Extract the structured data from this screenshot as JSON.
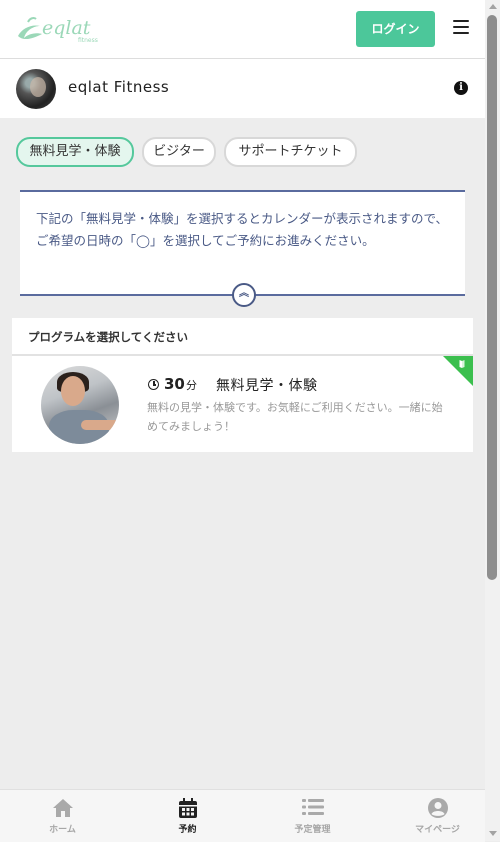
{
  "header": {
    "logo_text": "eqlat",
    "logo_subtext": "fitness",
    "login_label": "ログイン",
    "menu_icon": "hamburger-menu-icon"
  },
  "studio": {
    "name": "eqlat Fitness",
    "info_icon": "info-icon",
    "info_glyph": "i"
  },
  "filters": {
    "chips": [
      {
        "label": "無料見学・体験",
        "active": true
      },
      {
        "label": "ビジター",
        "active": false
      },
      {
        "label": "サポートチケット",
        "active": false
      }
    ]
  },
  "notice": {
    "text": "下記の「無料見学・体験」を選択するとカレンダーが表示されますので、ご希望の日時の「◯」を選択してご予約にお進みください。",
    "collapse_icon": "chevron-double-up-icon",
    "collapse_glyph": "︽"
  },
  "programs": {
    "header": "プログラムを選択してください",
    "items": [
      {
        "duration": "30",
        "duration_unit": "分",
        "title": "無料見学・体験",
        "description": "無料の見学・体験です。お気軽にご利用ください。一緒に始めてみましょう！",
        "badge_icon": "beginner-mark-icon"
      }
    ]
  },
  "bottom_nav": {
    "items": [
      {
        "label": "ホーム",
        "icon": "home-icon",
        "active": false
      },
      {
        "label": "予約",
        "icon": "calendar-icon",
        "active": true
      },
      {
        "label": "予定管理",
        "icon": "list-icon",
        "active": false
      },
      {
        "label": "マイページ",
        "icon": "user-circle-icon",
        "active": false
      }
    ]
  },
  "colors": {
    "accent_green": "#4cc79a",
    "notice_border": "#5a6b9e",
    "badge_green": "#3bbf4e"
  }
}
